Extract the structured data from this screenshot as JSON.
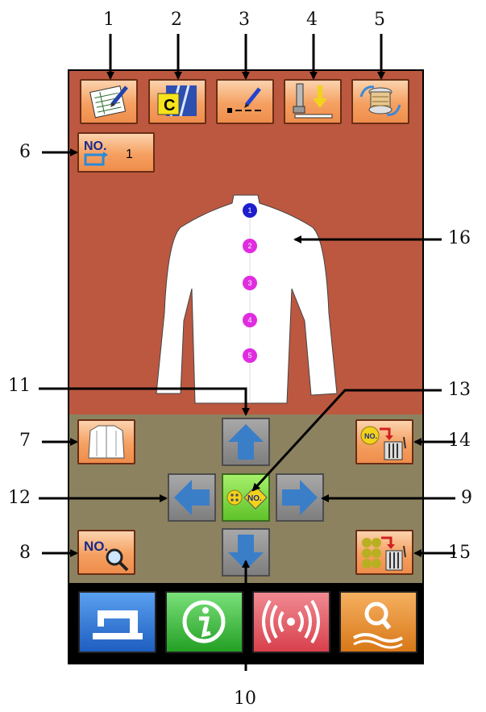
{
  "callouts": [
    "1",
    "2",
    "3",
    "4",
    "5",
    "6",
    "7",
    "8",
    "9",
    "10",
    "11",
    "12",
    "13",
    "14",
    "15",
    "16"
  ],
  "toolbar": {
    "no_label": "NO.",
    "pattern_no": "1",
    "c_label": "C"
  },
  "icons": {
    "b1": "edit-list-icon",
    "b2": "c-selector-icon",
    "b3": "stitch-pen-icon",
    "b4": "presser-foot-icon",
    "b5": "bobbin-winder-icon",
    "b6": "pattern-number-icon",
    "b7": "shirt-icon",
    "b8": "search-number-icon",
    "b14": "delete-number-icon",
    "b15": "delete-all-icon",
    "b16a": "sewing-machine-icon",
    "b16b": "info-icon",
    "b16c": "wireless-icon",
    "b16d": "search-icon",
    "up": "arrow-up-icon",
    "down": "arrow-down-icon",
    "left": "arrow-left-icon",
    "right": "arrow-right-icon",
    "center": "button-number-icon"
  },
  "shirt": {
    "buttons": [
      "1",
      "2",
      "3",
      "4",
      "5"
    ]
  },
  "center_button": {
    "label": "NO."
  },
  "small_labels": {
    "no_search": "NO.",
    "no_delete": "NO."
  },
  "colors": {
    "top_panel": "#BC5840",
    "mid_panel": "#8C8260",
    "orange_button": "#F5A061",
    "first_stitch_button": "#1E1ECC",
    "other_stitch_buttons": "#E02CE0",
    "sewing_button": "#2A73D8",
    "info_button": "#3BBF3B",
    "wireless_button": "#E0505A",
    "search_button": "#E88A28"
  }
}
